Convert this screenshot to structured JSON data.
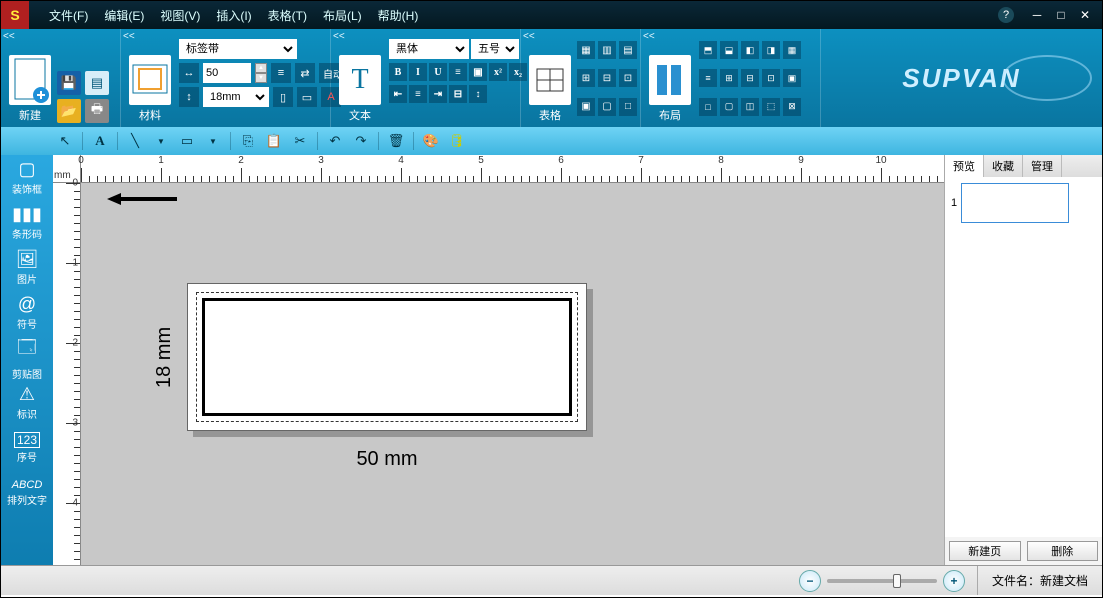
{
  "menu": {
    "file": "文件(F)",
    "edit": "编辑(E)",
    "view": "视图(V)",
    "insert": "插入(I)",
    "table": "表格(T)",
    "layout": "布局(L)",
    "help": "帮助(H)"
  },
  "ribbon": {
    "new_label": "新建",
    "material_label": "材料",
    "tape_type": "标签带",
    "width_val": "50",
    "height_sel": "18mm",
    "auto": "自动",
    "text_label": "文本",
    "font_name": "黑体",
    "font_size": "五号",
    "table_label": "表格",
    "layout_label": "布局"
  },
  "brand": "SUPVAN",
  "sidebar": {
    "frame": "装饰框",
    "barcode": "条形码",
    "image": "图片",
    "symbol": "符号",
    "clip": "剪贴图",
    "mark": "标识",
    "serial": "序号",
    "arrange": "排列文字"
  },
  "ruler_unit": "mm",
  "label": {
    "width_text": "50 mm",
    "height_text": "18 mm"
  },
  "panel": {
    "tab_preview": "预览",
    "tab_fav": "收藏",
    "tab_manage": "管理",
    "page_num": "1",
    "btn_newpage": "新建页",
    "btn_delete": "删除"
  },
  "status": {
    "file_label": "文件名：",
    "file_name": "新建文档"
  }
}
